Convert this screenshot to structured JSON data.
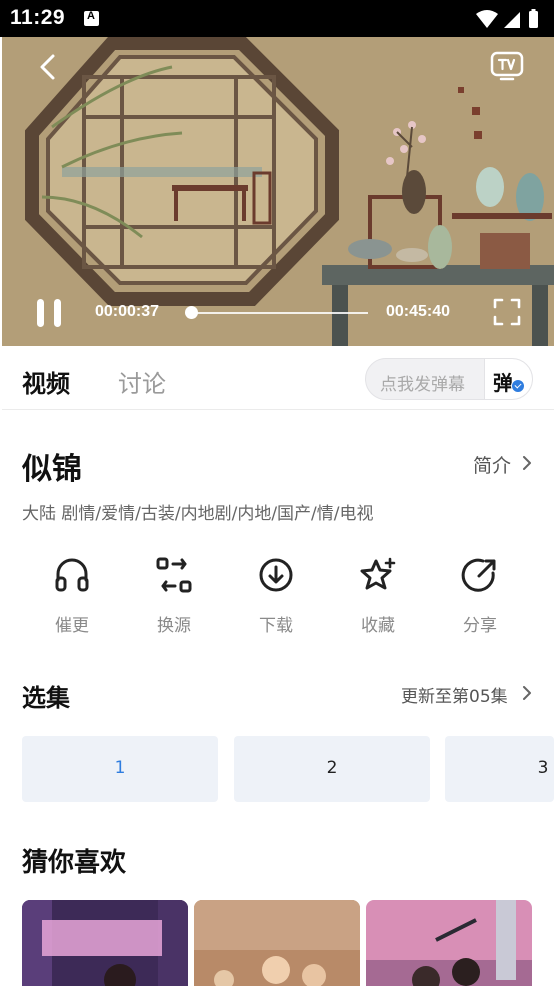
{
  "status_bar": {
    "time": "11:29"
  },
  "player": {
    "current_time": "00:00:37",
    "total_time": "00:45:40",
    "progress": 0.0135
  },
  "tabs": {
    "video": "视频",
    "discussion": "讨论"
  },
  "danmu": {
    "placeholder": "点我发弹幕",
    "toggle_label": "弹"
  },
  "show": {
    "title": "似锦",
    "intro_label": "简介",
    "tags": "大陆  剧情/爱情/古装/内地剧/内地/国产/情/电视"
  },
  "actions": [
    {
      "label": "催更",
      "icon": "headphones-icon"
    },
    {
      "label": "换源",
      "icon": "switch-source-icon"
    },
    {
      "label": "下载",
      "icon": "download-icon"
    },
    {
      "label": "收藏",
      "icon": "star-icon"
    },
    {
      "label": "分享",
      "icon": "share-icon"
    }
  ],
  "episodes": {
    "title": "选集",
    "more_label": "更新至第05集",
    "items": [
      "1",
      "2",
      "3"
    ],
    "selected": "1"
  },
  "recommendations": {
    "title": "猜你喜欢",
    "colors": {
      "accent": "#2f7ddf"
    }
  }
}
